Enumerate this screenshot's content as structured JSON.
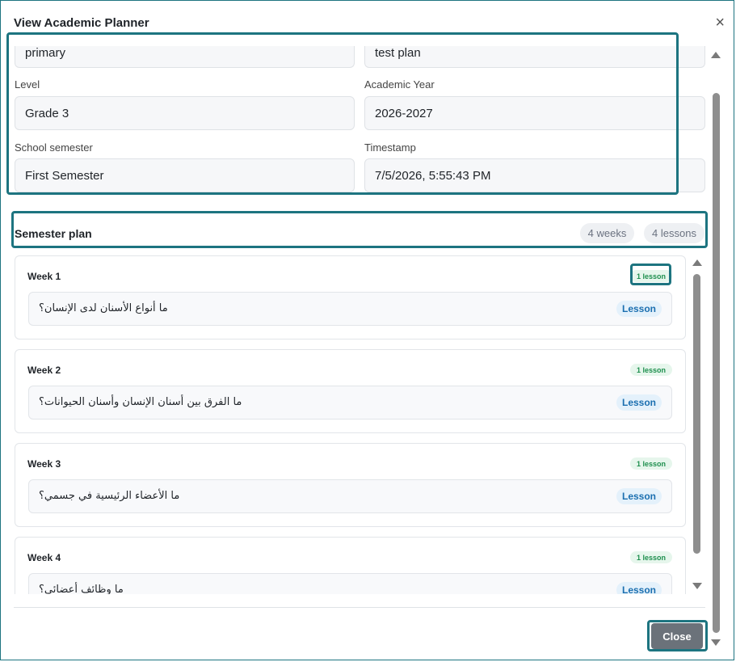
{
  "modal": {
    "title": "View Academic Planner",
    "close_symbol": "×"
  },
  "fields": {
    "stage_value": "primary",
    "plan_name_value": "test plan",
    "level_label": "Level",
    "level_value": "Grade 3",
    "year_label": "Academic Year",
    "year_value": "2026-2027",
    "semester_label": "School semester",
    "semester_value": "First Semester",
    "timestamp_label": "Timestamp",
    "timestamp_value": "7/5/2026, 5:55:43 PM"
  },
  "semester_plan": {
    "title": "Semester plan",
    "weeks_count": "4 weeks",
    "lessons_count": "4 lessons",
    "weeks": [
      {
        "title": "Week 1",
        "badge": "1 lesson",
        "lesson": "ما أنواع الأسنان لدى الإنسان؟",
        "tag": "Lesson"
      },
      {
        "title": "Week 2",
        "badge": "1 lesson",
        "lesson": "ما الفرق بين أسنان الإنسان وأسنان الحيوانات؟",
        "tag": "Lesson"
      },
      {
        "title": "Week 3",
        "badge": "1 lesson",
        "lesson": "ما الأعضاء الرئيسية في جسمي؟",
        "tag": "Lesson"
      },
      {
        "title": "Week 4",
        "badge": "1 lesson",
        "lesson": "ما وظائف أعضائي؟",
        "tag": "Lesson"
      }
    ]
  },
  "footer": {
    "close_label": "Close"
  },
  "colors": {
    "highlight": "#1d7480",
    "badge_green": "#1e8f4e",
    "lesson_blue": "#1b6fb0"
  }
}
